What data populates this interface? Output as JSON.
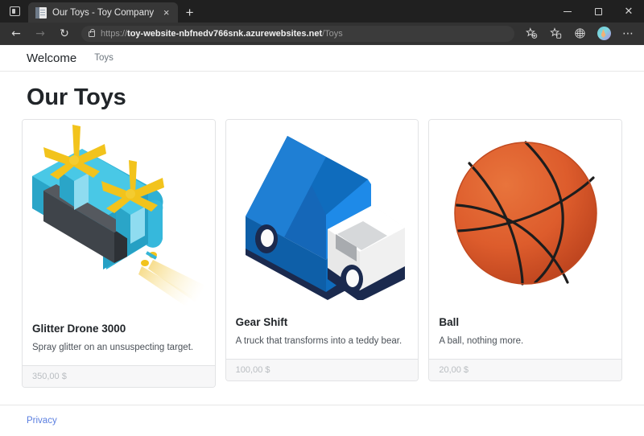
{
  "browser": {
    "tab_search_icon": "tab-search-icon",
    "tab": {
      "favicon": "page-favicon",
      "title": "Our Toys - Toy Company",
      "close_label": "×"
    },
    "new_tab_label": "+",
    "window_controls": {
      "minimize": "minimize-icon",
      "maximize": "maximize-icon",
      "close": "✕"
    },
    "toolbar": {
      "back": "←",
      "forward": "→",
      "refresh": "↻",
      "lock_icon": "lock-icon",
      "url_scheme": "https://",
      "url_host": "toy-website-nbfnedv766snk.azurewebsites.net",
      "url_path": "/Toys",
      "add_favorite": "add-favorite-icon",
      "favorites": "favorites-icon",
      "collections": "collections-icon",
      "profile": "profile-avatar",
      "settings_more": "⋯"
    }
  },
  "site": {
    "nav": {
      "brand": "Welcome",
      "links": [
        {
          "label": "Toys"
        }
      ]
    },
    "page_title": "Our Toys",
    "products": [
      {
        "name": "Glitter Drone 3000",
        "description": "Spray glitter on an unsuspecting target.",
        "price": "350,00 $",
        "image": "drone-illustration"
      },
      {
        "name": "Gear Shift",
        "description": "A truck that transforms into a teddy bear.",
        "price": "100,00 $",
        "image": "truck-illustration"
      },
      {
        "name": "Ball",
        "description": "A ball, nothing more.",
        "price": "20,00 $",
        "image": "basketball-illustration"
      }
    ],
    "footer": {
      "privacy_label": "Privacy"
    }
  },
  "colors": {
    "drone_body": "#33b5d9",
    "drone_propeller": "#f2c31c",
    "drone_panel": "#3f444a",
    "truck_box": "#0f6cbd",
    "truck_cab": "#f2f2f2",
    "truck_chassis": "#1b2a4e",
    "ball_orange": "#e06030",
    "link_blue": "#5b7fe0"
  }
}
